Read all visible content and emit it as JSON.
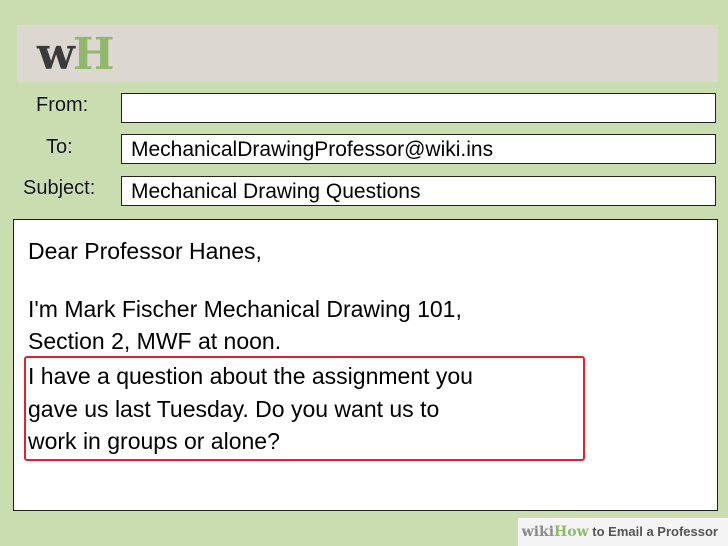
{
  "header": {
    "logo_w": "w",
    "logo_h": "H"
  },
  "fields": {
    "from_label": "From:",
    "from_value": "",
    "to_label": "To:",
    "to_value": "MechanicalDrawingProfessor@wiki.ins",
    "subject_label": "Subject:",
    "subject_value": "Mechanical Drawing Questions"
  },
  "body": {
    "greeting": "Dear Professor Hanes,",
    "line1": "I'm Mark Fischer Mechanical Drawing 101,",
    "line2": "Section 2, MWF at noon.",
    "line3": "I have a question about the assignment you",
    "line4": "gave us last Tuesday. Do you want us to",
    "line5": "work in groups or alone?"
  },
  "footer": {
    "wiki": "wiki",
    "how": "How",
    "title": " to Email a Professor"
  },
  "colors": {
    "background": "#c9ddb1",
    "header_bar": "#dcd7d0",
    "logo_green": "#8fb86b",
    "highlight_red": "#d9252f"
  }
}
